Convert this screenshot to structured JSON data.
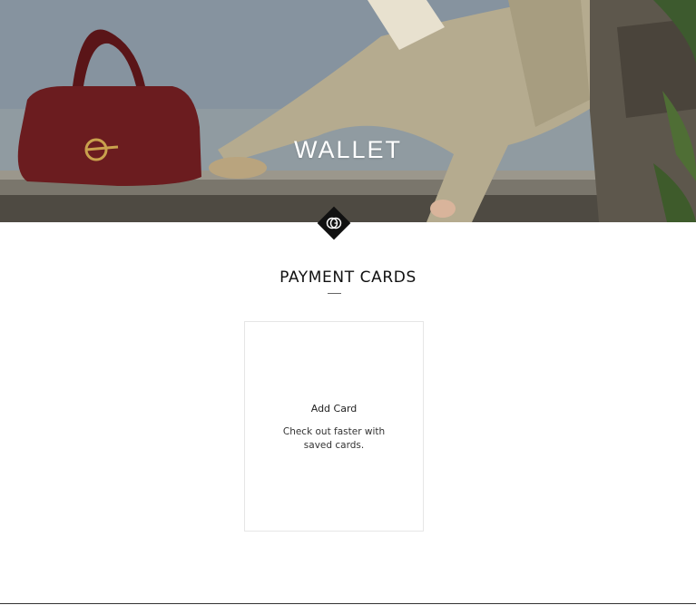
{
  "hero": {
    "title": "WALLET",
    "image": "hero-photo-bag-and-model"
  },
  "logo": {
    "icon": "gg-monogram-icon"
  },
  "section": {
    "title": "PAYMENT CARDS"
  },
  "add_card": {
    "label": "Add Card",
    "description": "Check out faster with saved cards."
  },
  "colors": {
    "hero_text": "#ffffff",
    "logo_badge": "#111111",
    "card_border": "#e6e6e6",
    "text": "#111111"
  }
}
